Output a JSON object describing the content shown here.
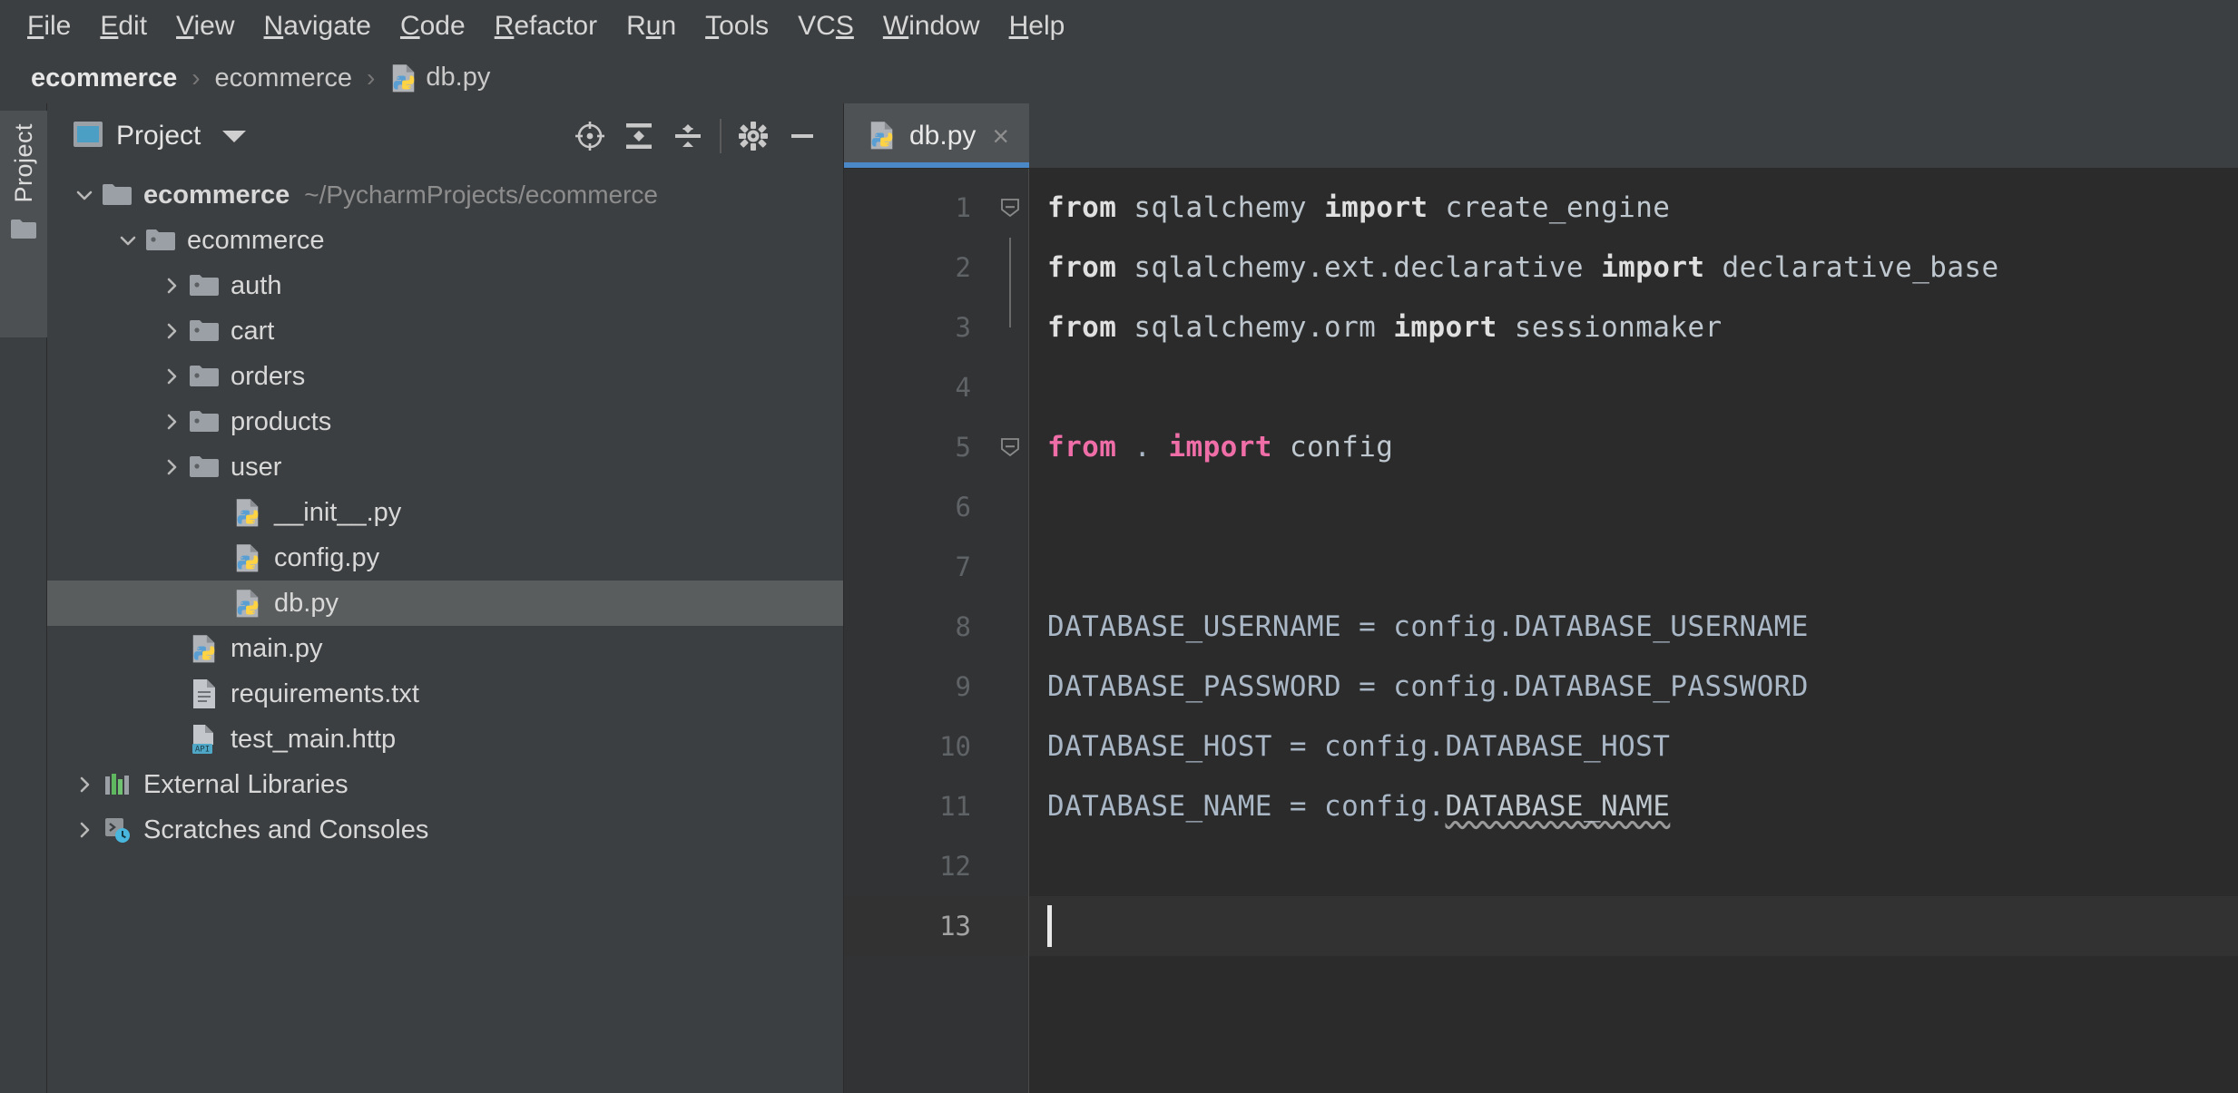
{
  "menubar": {
    "items": [
      {
        "label": "File",
        "mnemonic": "F"
      },
      {
        "label": "Edit",
        "mnemonic": "E"
      },
      {
        "label": "View",
        "mnemonic": "V"
      },
      {
        "label": "Navigate",
        "mnemonic": "N"
      },
      {
        "label": "Code",
        "mnemonic": "C"
      },
      {
        "label": "Refactor",
        "mnemonic": "R"
      },
      {
        "label": "Run",
        "mnemonic": "u"
      },
      {
        "label": "Tools",
        "mnemonic": "T"
      },
      {
        "label": "VCS",
        "mnemonic": "S"
      },
      {
        "label": "Window",
        "mnemonic": "W"
      },
      {
        "label": "Help",
        "mnemonic": "H"
      }
    ]
  },
  "breadcrumb": {
    "items": [
      {
        "label": "ecommerce",
        "icon": "none",
        "bold": true
      },
      {
        "label": "ecommerce",
        "icon": "none",
        "bold": false
      },
      {
        "label": "db.py",
        "icon": "python-file-icon",
        "bold": false
      }
    ],
    "separator": "›"
  },
  "stripe": {
    "label": "Project",
    "icon": "folder-icon"
  },
  "project_panel": {
    "title": "Project",
    "title_icon": "project-view-icon",
    "dropdown_icon": "chevron-down-icon",
    "toolbar": [
      {
        "name": "select-opened-file-icon",
        "tooltip": "Select Opened File"
      },
      {
        "name": "expand-all-icon",
        "tooltip": "Expand All"
      },
      {
        "name": "collapse-all-icon",
        "tooltip": "Collapse All"
      },
      {
        "name": "settings-gear-icon",
        "tooltip": "Settings"
      },
      {
        "name": "hide-panel-icon",
        "tooltip": "Hide"
      }
    ],
    "tree": [
      {
        "label": "ecommerce",
        "path": "~/PycharmProjects/ecommerce",
        "icon": "folder-icon",
        "twisty": "expanded",
        "indent": 0,
        "bold": true,
        "selected": false
      },
      {
        "label": "ecommerce",
        "path": "",
        "icon": "module-folder-icon",
        "twisty": "expanded",
        "indent": 1,
        "bold": false,
        "selected": false
      },
      {
        "label": "auth",
        "path": "",
        "icon": "module-folder-icon",
        "twisty": "collapsed",
        "indent": 2,
        "bold": false,
        "selected": false
      },
      {
        "label": "cart",
        "path": "",
        "icon": "module-folder-icon",
        "twisty": "collapsed",
        "indent": 2,
        "bold": false,
        "selected": false
      },
      {
        "label": "orders",
        "path": "",
        "icon": "module-folder-icon",
        "twisty": "collapsed",
        "indent": 2,
        "bold": false,
        "selected": false
      },
      {
        "label": "products",
        "path": "",
        "icon": "module-folder-icon",
        "twisty": "collapsed",
        "indent": 2,
        "bold": false,
        "selected": false
      },
      {
        "label": "user",
        "path": "",
        "icon": "module-folder-icon",
        "twisty": "collapsed",
        "indent": 2,
        "bold": false,
        "selected": false
      },
      {
        "label": "__init__.py",
        "path": "",
        "icon": "python-file-icon",
        "twisty": "none",
        "indent": 3,
        "bold": false,
        "selected": false
      },
      {
        "label": "config.py",
        "path": "",
        "icon": "python-file-icon",
        "twisty": "none",
        "indent": 3,
        "bold": false,
        "selected": false
      },
      {
        "label": "db.py",
        "path": "",
        "icon": "python-file-icon",
        "twisty": "none",
        "indent": 3,
        "bold": false,
        "selected": true
      },
      {
        "label": "main.py",
        "path": "",
        "icon": "python-file-icon",
        "twisty": "none",
        "indent": 2,
        "bold": false,
        "selected": false
      },
      {
        "label": "requirements.txt",
        "path": "",
        "icon": "text-file-icon",
        "twisty": "none",
        "indent": 2,
        "bold": false,
        "selected": false
      },
      {
        "label": "test_main.http",
        "path": "",
        "icon": "http-file-icon",
        "twisty": "none",
        "indent": 2,
        "bold": false,
        "selected": false
      },
      {
        "label": "External Libraries",
        "path": "",
        "icon": "external-libraries-icon",
        "twisty": "collapsed",
        "indent": 0,
        "bold": false,
        "selected": false
      },
      {
        "label": "Scratches and Consoles",
        "path": "",
        "icon": "scratches-icon",
        "twisty": "collapsed",
        "indent": 0,
        "bold": false,
        "selected": false
      }
    ]
  },
  "editor": {
    "tabs": [
      {
        "label": "db.py",
        "icon": "python-file-icon",
        "active": true,
        "close_glyph": "×"
      }
    ],
    "current_line": 13,
    "caret_line": 13,
    "caret_column": 1,
    "lines": [
      {
        "number": 1,
        "fold": "start",
        "tokens": [
          {
            "t": "from",
            "c": "kw-white"
          },
          {
            "t": " ",
            "c": "plain"
          },
          {
            "t": "sqlalchemy",
            "c": "ident"
          },
          {
            "t": " ",
            "c": "plain"
          },
          {
            "t": "import",
            "c": "kw-white"
          },
          {
            "t": " ",
            "c": "plain"
          },
          {
            "t": "create_engine",
            "c": "ident"
          }
        ]
      },
      {
        "number": 2,
        "fold": "mid",
        "tokens": [
          {
            "t": "from",
            "c": "kw-white"
          },
          {
            "t": " ",
            "c": "plain"
          },
          {
            "t": "sqlalchemy.ext.declarative",
            "c": "ident"
          },
          {
            "t": " ",
            "c": "plain"
          },
          {
            "t": "import",
            "c": "kw-white"
          },
          {
            "t": " ",
            "c": "plain"
          },
          {
            "t": "declarative_base",
            "c": "ident"
          }
        ]
      },
      {
        "number": 3,
        "fold": "end",
        "tokens": [
          {
            "t": "from",
            "c": "kw-white"
          },
          {
            "t": " ",
            "c": "plain"
          },
          {
            "t": "sqlalchemy.orm",
            "c": "ident"
          },
          {
            "t": " ",
            "c": "plain"
          },
          {
            "t": "import",
            "c": "kw-white"
          },
          {
            "t": " ",
            "c": "plain"
          },
          {
            "t": "sessionmaker",
            "c": "ident"
          }
        ]
      },
      {
        "number": 4,
        "fold": "none",
        "tokens": []
      },
      {
        "number": 5,
        "fold": "single",
        "tokens": [
          {
            "t": "from",
            "c": "kw-pink"
          },
          {
            "t": " . ",
            "c": "plain"
          },
          {
            "t": "import",
            "c": "kw-pink"
          },
          {
            "t": " ",
            "c": "plain"
          },
          {
            "t": "config",
            "c": "ident"
          }
        ]
      },
      {
        "number": 6,
        "fold": "none",
        "tokens": []
      },
      {
        "number": 7,
        "fold": "none",
        "tokens": []
      },
      {
        "number": 8,
        "fold": "none",
        "tokens": [
          {
            "t": "DATABASE_USERNAME = config.DATABASE_USERNAME",
            "c": "plain"
          }
        ]
      },
      {
        "number": 9,
        "fold": "none",
        "tokens": [
          {
            "t": "DATABASE_PASSWORD = config.DATABASE_PASSWORD",
            "c": "plain"
          }
        ]
      },
      {
        "number": 10,
        "fold": "none",
        "tokens": [
          {
            "t": "DATABASE_HOST = config.DATABASE_HOST",
            "c": "plain"
          }
        ]
      },
      {
        "number": 11,
        "fold": "none",
        "tokens": [
          {
            "t": "DATABASE_NAME = config.",
            "c": "plain"
          },
          {
            "t": "DATABASE_NAME",
            "c": "dotted"
          }
        ]
      },
      {
        "number": 12,
        "fold": "none",
        "tokens": []
      },
      {
        "number": 13,
        "fold": "none",
        "tokens": []
      }
    ]
  },
  "colors": {
    "chrome_bg": "#3c3f41",
    "editor_bg": "#2b2b2b",
    "gutter_bg": "#313335",
    "current_line_bg": "#323232",
    "selection_bg": "#5a5d5e",
    "tab_active_underline": "#4a88c7",
    "keyword_pink": "#ef6ea8",
    "text_fg": "#a9b7c6"
  }
}
